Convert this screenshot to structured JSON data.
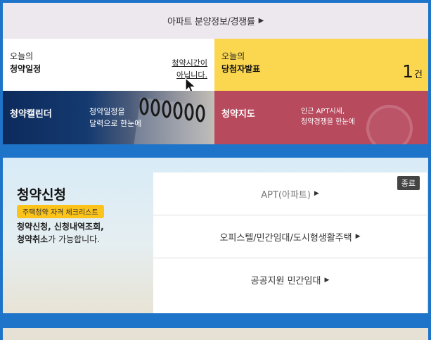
{
  "top_banner": {
    "label": "아파트 분양정보/경쟁률",
    "arrow": "▶"
  },
  "schedule": {
    "title_small": "오늘의",
    "title": "청약일정",
    "notice_line1": "청약시간이",
    "notice_line2": "아닙니다."
  },
  "winners": {
    "title_small": "오늘의",
    "title": "당첨자발표",
    "count": "1",
    "count_unit": "건"
  },
  "calendar": {
    "title": "청약캘린더",
    "desc_line1": "청약일정을",
    "desc_line2": "달력으로 한눈에"
  },
  "map": {
    "title": "청약지도",
    "desc_line1": "인근 APT시세,",
    "desc_line2": "청약경쟁을 한눈에"
  },
  "apply": {
    "title": "청약신청",
    "checklist_label": "주택청약 자격 체크리스트",
    "desc_line1_bold": "청약신청, 신청내역조회,",
    "desc_line2_bold": "청약취소",
    "desc_line2_rest": "가 가능합니다.",
    "closed_badge": "종료",
    "items": [
      {
        "label": "APT(아파트)",
        "arrow": "▶"
      },
      {
        "label": "오피스텔/민간임대/도시형생활주택",
        "arrow": "▶"
      },
      {
        "label": "공공지원 민간임대",
        "arrow": "▶"
      }
    ]
  },
  "colors": {
    "background": "#1e74c8",
    "winner_bg": "#fbd750",
    "calendar_bg": "#0d2a5c",
    "map_bg": "#b84a5e",
    "badge": "#fcc41b"
  }
}
